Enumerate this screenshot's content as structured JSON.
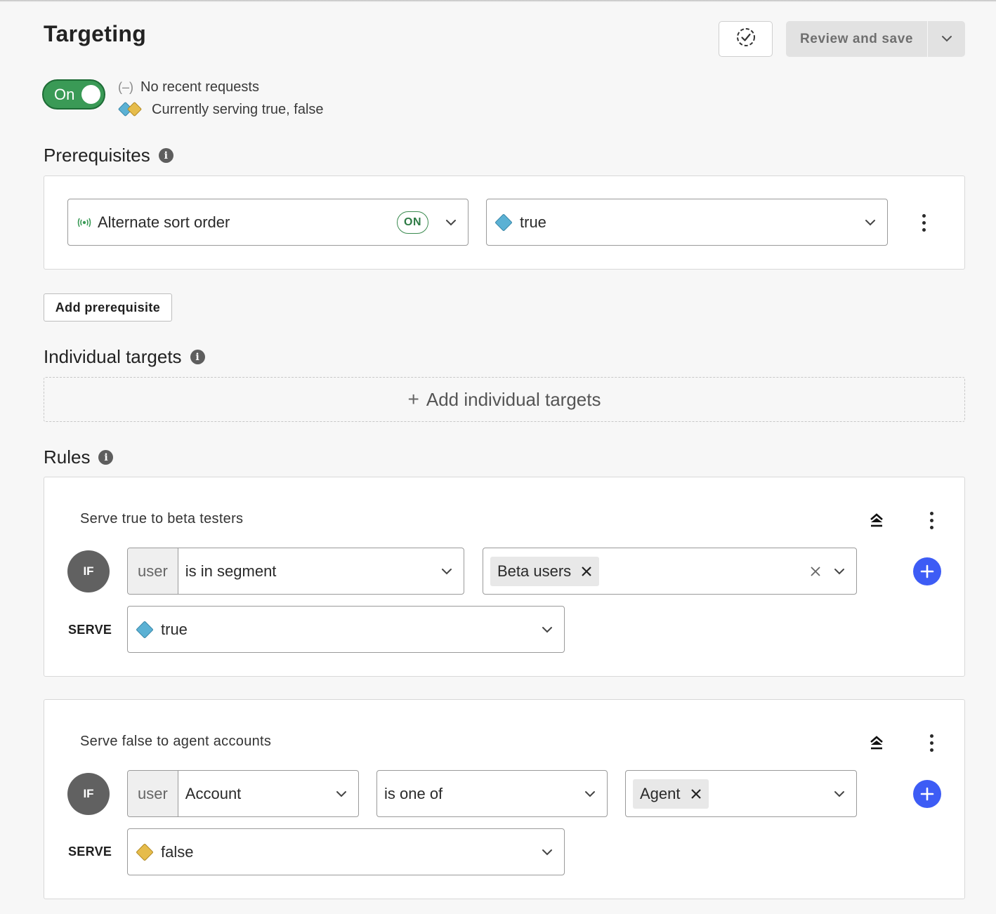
{
  "header": {
    "title": "Targeting",
    "review_label": "Review and save"
  },
  "toggle": {
    "label": "On",
    "state": "on"
  },
  "status": {
    "requests": "No recent requests",
    "serving": "Currently serving true, false"
  },
  "colors": {
    "true_variation": "#5bb1d4",
    "false_variation": "#e6bc4b",
    "toggle_on": "#3a9a56",
    "add_rule": "#3d5cf5"
  },
  "prerequisites": {
    "title": "Prerequisites",
    "flag_name": "Alternate sort order",
    "flag_status": "ON",
    "variation": "true",
    "add_label": "Add prerequisite"
  },
  "individual_targets": {
    "title": "Individual targets",
    "add_label": "Add individual targets"
  },
  "rules": {
    "title": "Rules",
    "items": [
      {
        "name": "Serve true to beta testers",
        "if_label": "IF",
        "context": "user",
        "attribute": "is in segment",
        "values": [
          "Beta users"
        ],
        "serve_label": "SERVE",
        "serve": "true"
      },
      {
        "name": "Serve false to agent accounts",
        "if_label": "IF",
        "context": "user",
        "attribute": "Account",
        "operator": "is one of",
        "values": [
          "Agent"
        ],
        "serve_label": "SERVE",
        "serve": "false"
      }
    ]
  }
}
